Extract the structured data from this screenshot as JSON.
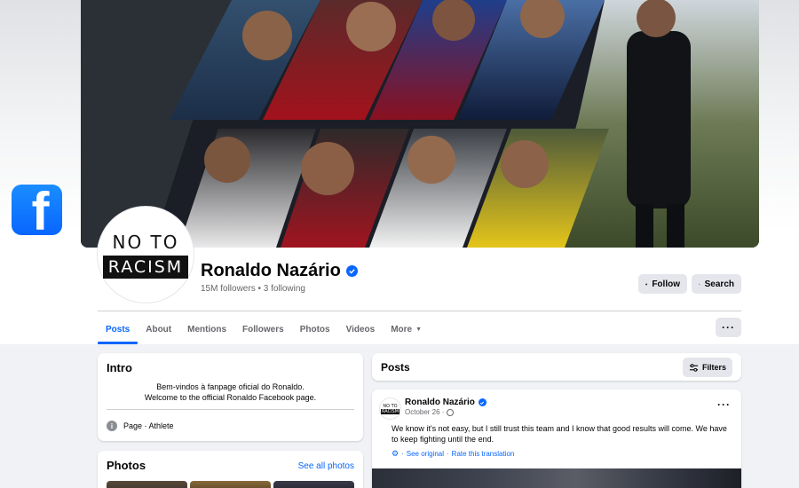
{
  "brand": {
    "icon": "facebook-f-icon",
    "glyph": "f",
    "color": "#0866ff"
  },
  "profile": {
    "avatar": {
      "line1": "NO TO",
      "line2": "RACISM"
    },
    "name": "Ronaldo Nazário",
    "stats": "15M followers • 3 following"
  },
  "actions": {
    "follow": "Follow",
    "search": "Search",
    "more": "···"
  },
  "tabs": [
    {
      "label": "Posts",
      "active": true
    },
    {
      "label": "About"
    },
    {
      "label": "Mentions"
    },
    {
      "label": "Followers"
    },
    {
      "label": "Photos"
    },
    {
      "label": "Videos"
    },
    {
      "label": "More"
    }
  ],
  "intro": {
    "title": "Intro",
    "bio_line1": "Bem-vindos à fanpage oficial do Ronaldo.",
    "bio_line2": "Welcome to the official Ronaldo Facebook page.",
    "category": "Page · Athlete"
  },
  "photos": {
    "title": "Photos",
    "see_all": "See all photos"
  },
  "posts": {
    "title": "Posts",
    "filters": "Filters",
    "items": [
      {
        "author": "Ronaldo Nazário",
        "date": "October 26 ·",
        "text": "We know it's not easy, but I still trust this team and I know that good results will come. We have to keep fighting until the end.",
        "see_original": "See original",
        "rate": "Rate this translation",
        "separator": "·"
      }
    ]
  },
  "colors": {
    "accent": "#0866ff",
    "muted": "#65676b",
    "background": "#f0f2f5",
    "button": "#e4e6eb"
  }
}
